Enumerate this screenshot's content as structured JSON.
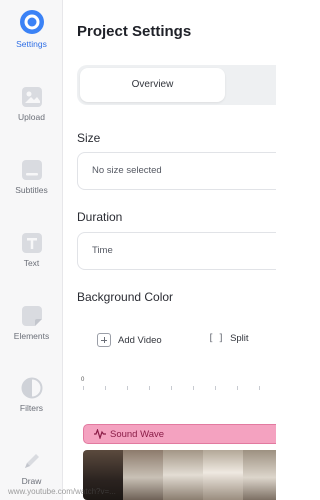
{
  "sidebar": {
    "items": [
      {
        "label": "Settings",
        "icon": "settings-icon",
        "active": true
      },
      {
        "label": "Upload",
        "icon": "upload-icon"
      },
      {
        "label": "Subtitles",
        "icon": "subtitles-icon"
      },
      {
        "label": "Text",
        "icon": "text-icon"
      },
      {
        "label": "Elements",
        "icon": "elements-icon"
      },
      {
        "label": "Filters",
        "icon": "filters-icon"
      },
      {
        "label": "Draw",
        "icon": "draw-icon"
      }
    ]
  },
  "main": {
    "title": "Project Settings",
    "tabs": [
      {
        "label": "Overview"
      }
    ],
    "size": {
      "label": "Size",
      "value": "No size selected"
    },
    "duration": {
      "label": "Duration",
      "value": "Time"
    },
    "background_color": {
      "label": "Background Color"
    }
  },
  "timeline": {
    "add_video_label": "Add Video",
    "split_label": "Split",
    "split_icon_glyph": "[ ]",
    "ruler_zero": "0",
    "sound_wave_label": "Sound Wave"
  },
  "watermark": "www.youtube.com/watch?v=...",
  "colors": {
    "accent": "#2f6fe6",
    "sound_wave": "#f4a2c0"
  }
}
